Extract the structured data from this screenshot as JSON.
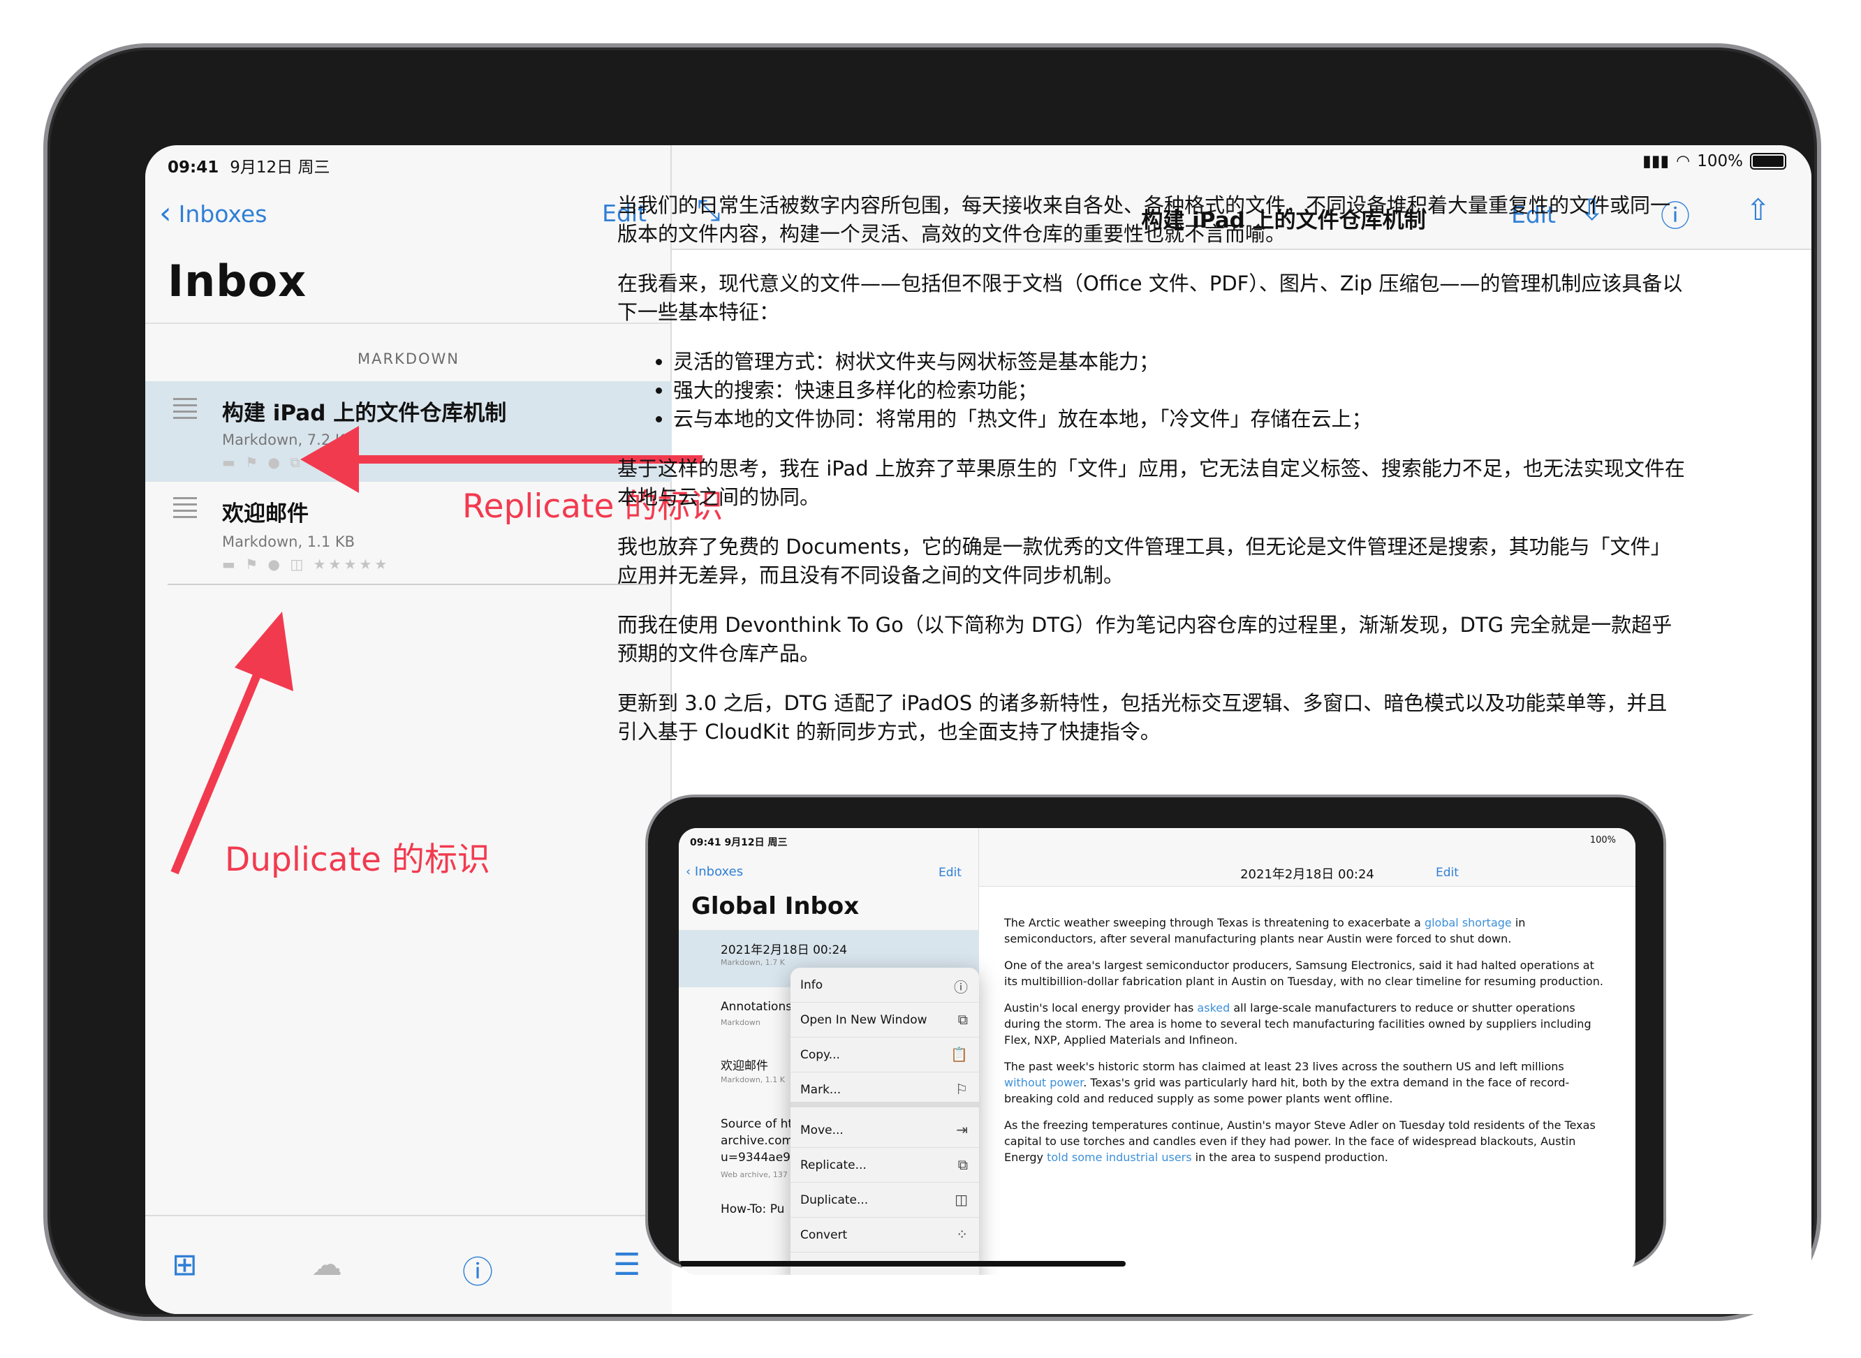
{
  "status": {
    "time": "09:41",
    "date": "9月12日 周三",
    "battery": "100%"
  },
  "sidebar": {
    "back_label": "Inboxes",
    "edit_label": "Edit",
    "title": "Inbox",
    "section": "MARKDOWN",
    "items": [
      {
        "title": "构建 iPad 上的文件仓库机制",
        "meta": "Markdown, 7.2 KB",
        "flags": "▬ ⚑ ● ⧉"
      },
      {
        "title": "欢迎邮件",
        "meta": "Markdown, 1.1 KB",
        "flags": "▬ ⚑ ● ◫ ★★★★★"
      }
    ]
  },
  "toolbar": {
    "icons": [
      "add-icon",
      "cloud-icon",
      "info-icon",
      "list-icon"
    ]
  },
  "annotations": {
    "replicate": "Replicate 的标识",
    "duplicate": "Duplicate 的标识",
    "color": "#f23a4f"
  },
  "document": {
    "title": "构建 iPad 上的文件仓库机制",
    "edit_label": "Edit",
    "paragraphs": [
      "当我们的日常生活被数字内容所包围，每天接收来自各处、各种格式的文件，不同设备堆积着大量重复性的文件或同一版本的文件内容，构建一个灵活、高效的文件仓库的重要性也就不言而喻。",
      "在我看来，现代意义的文件——包括但不限于文档（Office 文件、PDF）、图片、Zip 压缩包——的管理机制应该具备以下一些基本特征："
    ],
    "bullets": [
      "灵活的管理方式：树状文件夹与网状标签是基本能力；",
      "强大的搜索：快速且多样化的检索功能；",
      "云与本地的文件协同：将常用的「热文件」放在本地，「冷文件」存储在云上；"
    ],
    "paragraphs2": [
      "基于这样的思考，我在 iPad 上放弃了苹果原生的「文件」应用，它无法自定义标签、搜索能力不足，也无法实现文件在本地与云之间的协同。",
      "我也放弃了免费的 Documents，它的确是一款优秀的文件管理工具，但无论是文件管理还是搜索，其功能与「文件」应用并无差异，而且没有不同设备之间的文件同步机制。",
      "而我在使用 Devonthink To Go（以下简称为 DTG）作为笔记内容仓库的过程里，渐渐发现，DTG 完全就是一款超乎预期的文件仓库产品。",
      "更新到 3.0 之后，DTG 适配了 iPadOS 的诸多新特性，包括光标交互逻辑、多窗口、暗色模式以及功能菜单等，并且引入基于 CloudKit 的新同步方式，也全面支持了快捷指令。"
    ]
  },
  "mini": {
    "status_time": "09:41  9月12日 周三",
    "battery": "100%",
    "back_label": "Inboxes",
    "edit_label": "Edit",
    "title": "Global Inbox",
    "doc_title": "2021年2月18日 00:24",
    "rows": [
      {
        "title": "2021年2月18日 00:24",
        "meta": "Markdown, 1.7 K"
      },
      {
        "title": "Annotations",
        "meta": "Markdown"
      },
      {
        "title": "欢迎邮件",
        "meta": "Markdown, 1.1 K"
      },
      {
        "title": "Source of ht",
        "title2": "archive.com",
        "title3": "u=9344ae9",
        "meta": "Web archive, 137"
      },
      {
        "title": "How-To: Pu"
      }
    ],
    "menu": [
      {
        "label": "Info",
        "icon": "ⓘ"
      },
      {
        "label": "Open In New Window",
        "icon": "⧉"
      },
      {
        "label": "Copy...",
        "icon": "📋"
      },
      {
        "label": "Mark...",
        "icon": "⚐"
      },
      {
        "label": "Move...",
        "icon": "⇥"
      },
      {
        "label": "Replicate...",
        "icon": "⧉"
      },
      {
        "label": "Duplicate...",
        "icon": "◫"
      },
      {
        "label": "Convert",
        "icon": "⁘"
      }
    ],
    "paragraphs": [
      {
        "pre": "The Arctic weather sweeping through Texas is threatening to exacerbate a ",
        "link": "global shortage",
        "post": " in semiconductors, after several manufacturing plants near Austin were forced to shut down."
      },
      {
        "pre": "One of the area's largest semiconductor producers, Samsung Electronics, said it had halted operations at its multibillion-dollar fabrication plant in Austin on Tuesday, with no clear timeline for resuming production.",
        "link": "",
        "post": ""
      },
      {
        "pre": "Austin's local energy provider has ",
        "link": "asked",
        "post": " all large-scale manufacturers to reduce or shutter operations during the storm. The area is home to several tech manufacturing facilities owned by suppliers including Flex, NXP, Applied Materials and Infineon."
      },
      {
        "pre": "The past week's historic storm has claimed at least 23 lives across the southern US and left millions ",
        "link": "without power",
        "post": ". Texas's grid was particularly hard hit, both by the extra demand in the face of record-breaking cold and reduced supply as some power plants went offline."
      },
      {
        "pre": "As the freezing temperatures continue, Austin's mayor Steve Adler on Tuesday told residents of the Texas capital to use torches and candles even if they had power. In the face of widespread blackouts, Austin Energy ",
        "link": "told some industrial users",
        "post": " in the area to suspend production."
      }
    ]
  }
}
